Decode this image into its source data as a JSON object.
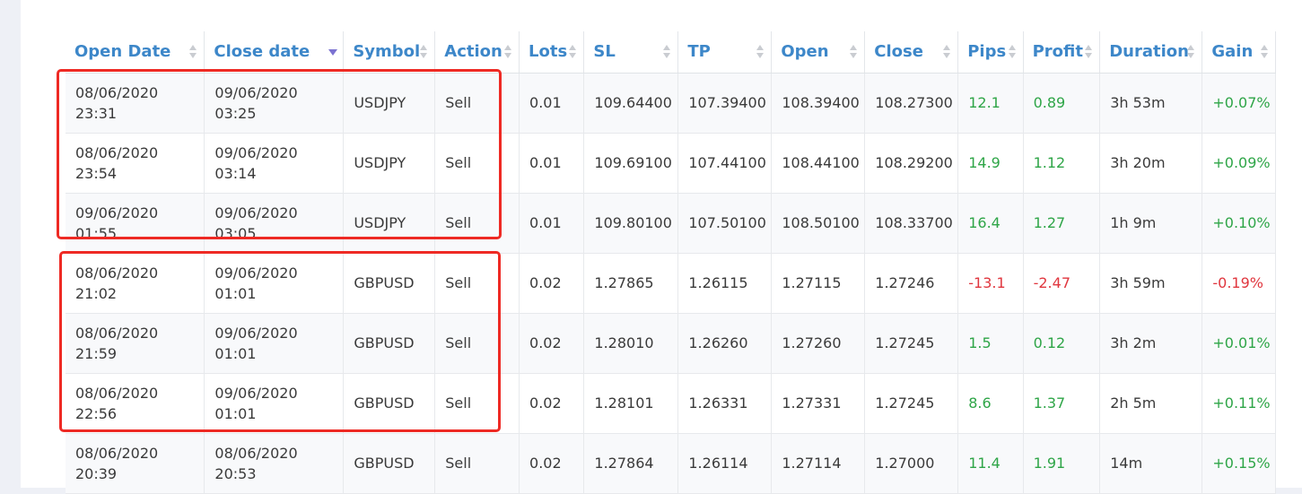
{
  "columns": [
    "Open Date",
    "Close date",
    "Symbol",
    "Action",
    "Lots",
    "SL",
    "TP",
    "Open",
    "Close",
    "Pips",
    "Profit",
    "Duration",
    "Gain"
  ],
  "rows": [
    {
      "open_date": "08/06/2020",
      "open_time": "23:31",
      "close_date": "09/06/2020",
      "close_time": "03:25",
      "symbol": "USDJPY",
      "action": "Sell",
      "lots": "0.01",
      "sl": "109.64400",
      "tp": "107.39400",
      "open": "108.39400",
      "close": "108.27300",
      "pips": "12.1",
      "profit": "0.89",
      "duration": "3h 53m",
      "gain": "+0.07%",
      "positive": true
    },
    {
      "open_date": "08/06/2020",
      "open_time": "23:54",
      "close_date": "09/06/2020",
      "close_time": "03:14",
      "symbol": "USDJPY",
      "action": "Sell",
      "lots": "0.01",
      "sl": "109.69100",
      "tp": "107.44100",
      "open": "108.44100",
      "close": "108.29200",
      "pips": "14.9",
      "profit": "1.12",
      "duration": "3h 20m",
      "gain": "+0.09%",
      "positive": true
    },
    {
      "open_date": "09/06/2020",
      "open_time": "01:55",
      "close_date": "09/06/2020",
      "close_time": "03:05",
      "symbol": "USDJPY",
      "action": "Sell",
      "lots": "0.01",
      "sl": "109.80100",
      "tp": "107.50100",
      "open": "108.50100",
      "close": "108.33700",
      "pips": "16.4",
      "profit": "1.27",
      "duration": "1h 9m",
      "gain": "+0.10%",
      "positive": true
    },
    {
      "open_date": "08/06/2020",
      "open_time": "21:02",
      "close_date": "09/06/2020",
      "close_time": "01:01",
      "symbol": "GBPUSD",
      "action": "Sell",
      "lots": "0.02",
      "sl": "1.27865",
      "tp": "1.26115",
      "open": "1.27115",
      "close": "1.27246",
      "pips": "-13.1",
      "profit": "-2.47",
      "duration": "3h 59m",
      "gain": "-0.19%",
      "positive": false
    },
    {
      "open_date": "08/06/2020",
      "open_time": "21:59",
      "close_date": "09/06/2020",
      "close_time": "01:01",
      "symbol": "GBPUSD",
      "action": "Sell",
      "lots": "0.02",
      "sl": "1.28010",
      "tp": "1.26260",
      "open": "1.27260",
      "close": "1.27245",
      "pips": "1.5",
      "profit": "0.12",
      "duration": "3h 2m",
      "gain": "+0.01%",
      "positive": true
    },
    {
      "open_date": "08/06/2020",
      "open_time": "22:56",
      "close_date": "09/06/2020",
      "close_time": "01:01",
      "symbol": "GBPUSD",
      "action": "Sell",
      "lots": "0.02",
      "sl": "1.28101",
      "tp": "1.26331",
      "open": "1.27331",
      "close": "1.27245",
      "pips": "8.6",
      "profit": "1.37",
      "duration": "2h 5m",
      "gain": "+0.11%",
      "positive": true
    },
    {
      "open_date": "08/06/2020",
      "open_time": "20:39",
      "close_date": "08/06/2020",
      "close_time": "20:53",
      "symbol": "GBPUSD",
      "action": "Sell",
      "lots": "0.02",
      "sl": "1.27864",
      "tp": "1.26114",
      "open": "1.27114",
      "close": "1.27000",
      "pips": "11.4",
      "profit": "1.91",
      "duration": "14m",
      "gain": "+0.15%",
      "positive": true
    }
  ],
  "sorted_column": "Close date",
  "sort_direction": "descending",
  "colors": {
    "header_text": "#3d87c9",
    "positive": "#2ea547",
    "negative": "#e0363e",
    "highlight_box": "#ee2a24",
    "sort_active": "#7b72d1"
  }
}
